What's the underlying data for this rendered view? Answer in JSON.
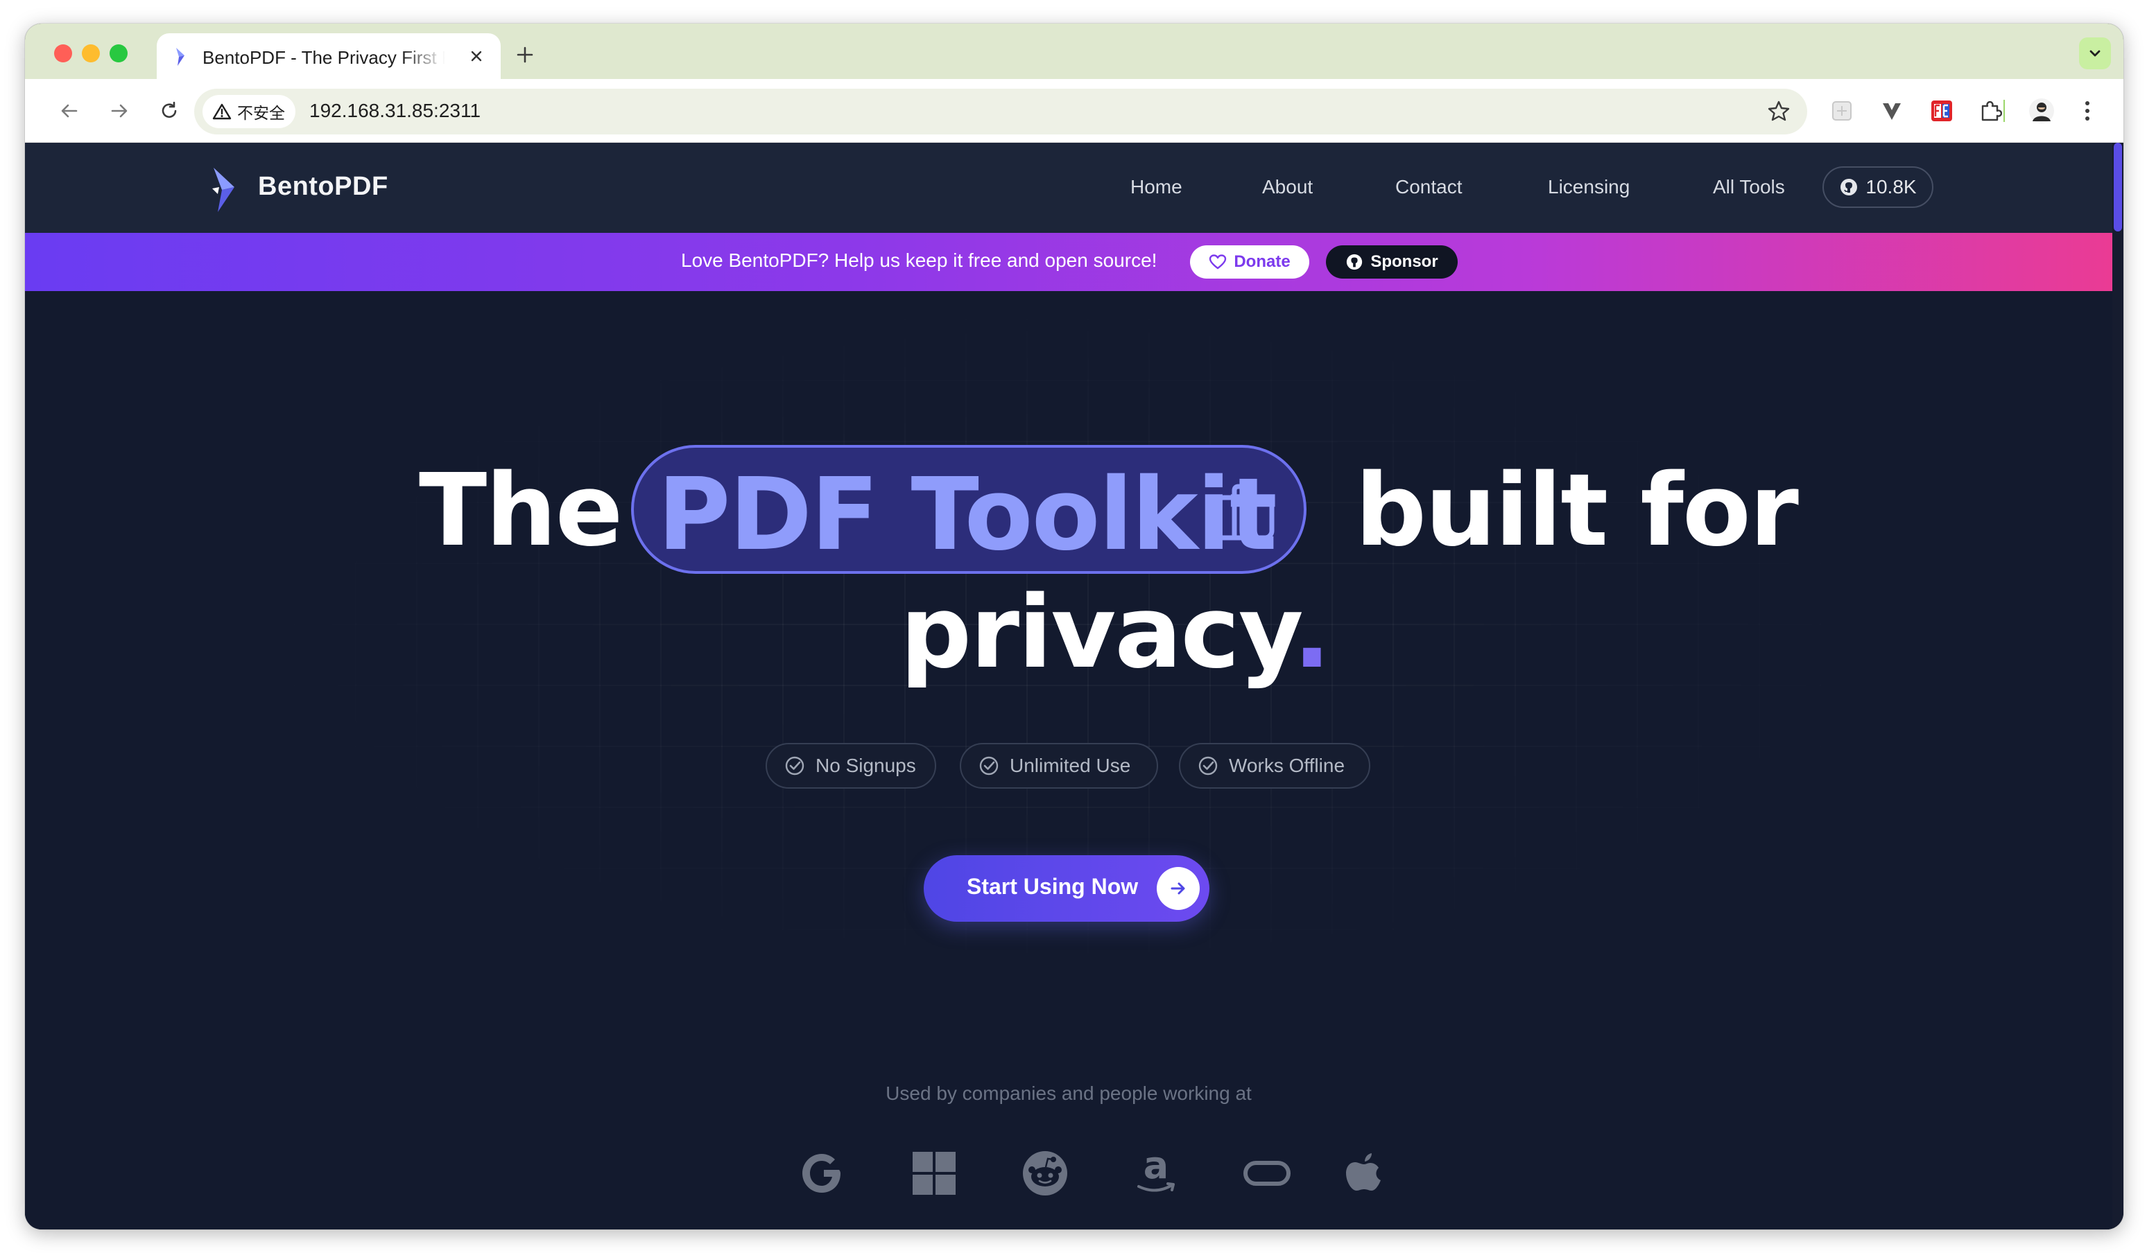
{
  "browser": {
    "tab_title": "BentoPDF - The Privacy First PDF Toolkit",
    "security_label": "不安全",
    "url": "192.168.31.85:2311"
  },
  "site": {
    "brand": "BentoPDF",
    "nav": {
      "home": "Home",
      "about": "About",
      "contact": "Contact",
      "licensing": "Licensing",
      "all_tools": "All Tools"
    },
    "github_stars": "10.8K"
  },
  "banner": {
    "message": "Love BentoPDF? Help us keep it free and open source!",
    "donate_label": "Donate",
    "sponsor_label": "Sponsor"
  },
  "hero": {
    "headline_the": "The",
    "headline_highlight": "PDF Toolkit",
    "headline_built_for": "built for",
    "headline_privacy": "privacy",
    "headline_dot": ".",
    "features": [
      "No Signups",
      "Unlimited Use",
      "Works Offline"
    ],
    "cta_label": "Start Using Now"
  },
  "social_proof": {
    "caption": "Used by companies and people working at",
    "logos": [
      "google-icon",
      "microsoft-icon",
      "reddit-icon",
      "amazon-icon",
      "oracle-icon",
      "apple-icon"
    ]
  },
  "colors": {
    "accent": "#6366f1",
    "highlight_text": "#8f9cfb",
    "banner_start": "#6a3cf2",
    "banner_end": "#ea3b94",
    "page_bg": "#131a2e"
  }
}
